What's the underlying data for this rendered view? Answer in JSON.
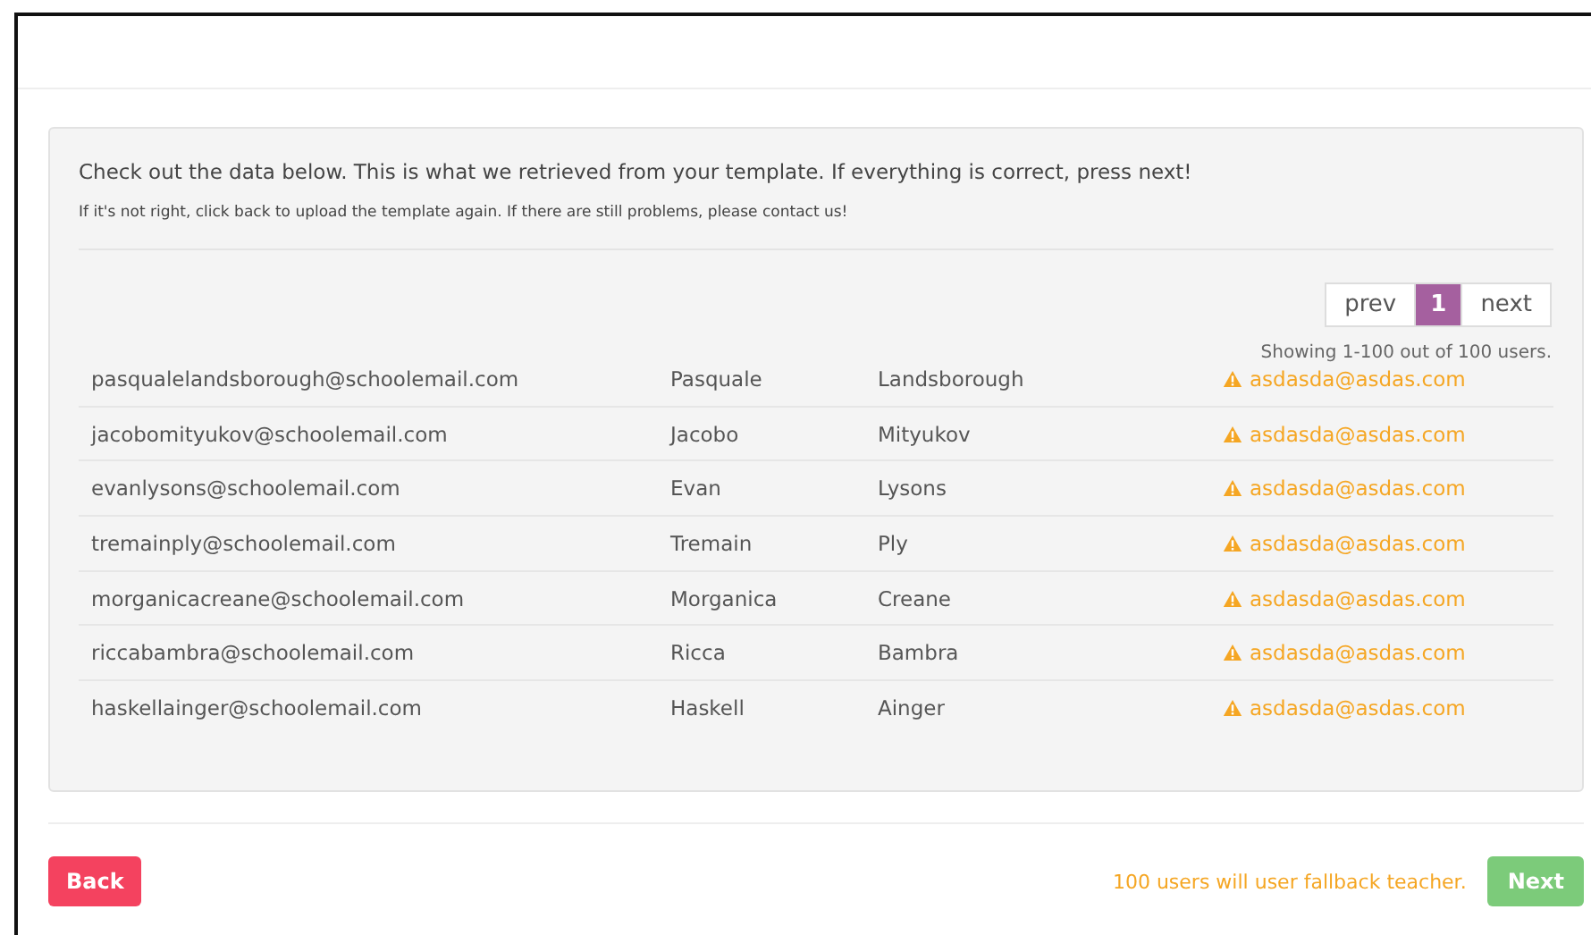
{
  "intro": {
    "message": "Check out the data below. This is what we retrieved from your template. If everything is correct, press next!",
    "hint": "If it's not right, click back to upload the template again. If there are still problems, please contact us!"
  },
  "pagination": {
    "prev": "prev",
    "next": "next",
    "pages": [
      {
        "label": "1",
        "selected": true
      }
    ],
    "summary": "Showing 1-100 out of 100 users."
  },
  "rows": [
    {
      "email": "pasqualelandsborough@schoolemail.com",
      "first_name": "Pasquale",
      "last_name": "Landsborough",
      "teacher": "asdasda@asdas.com",
      "warning": true
    },
    {
      "email": "jacobomityukov@schoolemail.com",
      "first_name": "Jacobo",
      "last_name": "Mityukov",
      "teacher": "asdasda@asdas.com",
      "warning": true
    },
    {
      "email": "evanlysons@schoolemail.com",
      "first_name": "Evan",
      "last_name": "Lysons",
      "teacher": "asdasda@asdas.com",
      "warning": true
    },
    {
      "email": "tremainply@schoolemail.com",
      "first_name": "Tremain",
      "last_name": "Ply",
      "teacher": "asdasda@asdas.com",
      "warning": true
    },
    {
      "email": "morganicacreane@schoolemail.com",
      "first_name": "Morganica",
      "last_name": "Creane",
      "teacher": "asdasda@asdas.com",
      "warning": true
    },
    {
      "email": "riccabambra@schoolemail.com",
      "first_name": "Ricca",
      "last_name": "Bambra",
      "teacher": "asdasda@asdas.com",
      "warning": true
    },
    {
      "email": "haskellainger@schoolemail.com",
      "first_name": "Haskell",
      "last_name": "Ainger",
      "teacher": "asdasda@asdas.com",
      "warning": true
    }
  ],
  "footer": {
    "back": "Back",
    "notice": "100 users will user fallback teacher.",
    "next": "Next"
  }
}
